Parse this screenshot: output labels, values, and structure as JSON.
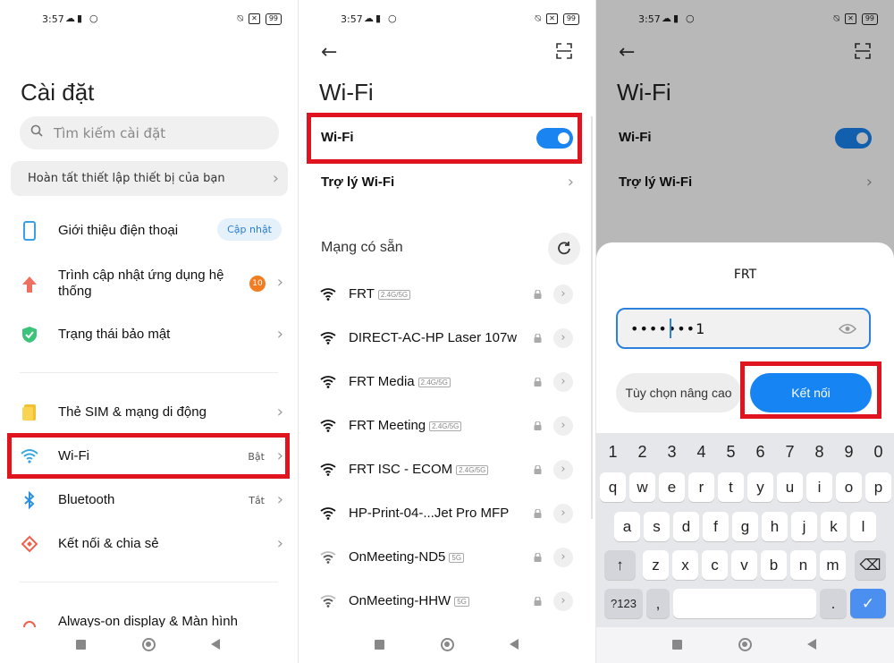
{
  "status": {
    "time": "3:57",
    "battery": "99"
  },
  "settings": {
    "title": "Cài đặt",
    "search_placeholder": "Tìm kiếm cài đặt",
    "setup_banner": "Hoàn tất thiết lập thiết bị của bạn",
    "items": [
      {
        "label": "Giới thiệu điện thoại",
        "badge": "Cập nhật"
      },
      {
        "label": "Trình cập nhật ứng dụng hệ thống",
        "badge": "10"
      },
      {
        "label": "Trạng thái bảo mật"
      },
      {
        "label": "Thẻ SIM & mạng di động"
      },
      {
        "label": "Wi-Fi",
        "value": "Bật"
      },
      {
        "label": "Bluetooth",
        "value": "Tắt"
      },
      {
        "label": "Kết nối & chia sẻ"
      },
      {
        "label": "Always-on display & Màn hình"
      }
    ]
  },
  "wifi": {
    "title": "Wi-Fi",
    "toggle_label": "Wi-Fi",
    "toggle_on": true,
    "assistant_label": "Trợ lý Wi-Fi",
    "available_label": "Mạng có sẵn",
    "networks": [
      {
        "name": "FRT",
        "tag": "2.4G/5G",
        "locked": true
      },
      {
        "name": "DIRECT-AC-HP Laser 107w",
        "tag": "",
        "locked": true
      },
      {
        "name": "FRT Media",
        "tag": "2.4G/5G",
        "locked": true
      },
      {
        "name": "FRT Meeting",
        "tag": "2.4G/5G",
        "locked": true
      },
      {
        "name": "FRT ISC - ECOM",
        "tag": "2.4G/5G",
        "locked": true
      },
      {
        "name": "HP-Print-04-...Jet Pro MFP",
        "tag": "",
        "locked": true
      },
      {
        "name": "OnMeeting-ND5",
        "tag": "5G",
        "locked": true
      },
      {
        "name": "OnMeeting-HHW",
        "tag": "5G",
        "locked": true
      }
    ]
  },
  "dialog": {
    "network_name": "FRT",
    "password_value": "•••••••1",
    "advanced_label": "Tùy chọn nâng cao",
    "connect_label": "Kết nối"
  },
  "keyboard": {
    "numbers": [
      "1",
      "2",
      "3",
      "4",
      "5",
      "6",
      "7",
      "8",
      "9",
      "0"
    ],
    "row1": [
      "q",
      "w",
      "e",
      "r",
      "t",
      "y",
      "u",
      "i",
      "o",
      "p"
    ],
    "row2": [
      "a",
      "s",
      "d",
      "f",
      "g",
      "h",
      "j",
      "k",
      "l"
    ],
    "row3": [
      "z",
      "x",
      "c",
      "v",
      "b",
      "n",
      "m"
    ],
    "symbols_key": "?123",
    "comma_key": ",",
    "period_key": "."
  },
  "colors": {
    "accent": "#1a84f0",
    "highlight_box": "#e0141e",
    "badge_orange": "#f27c22"
  }
}
